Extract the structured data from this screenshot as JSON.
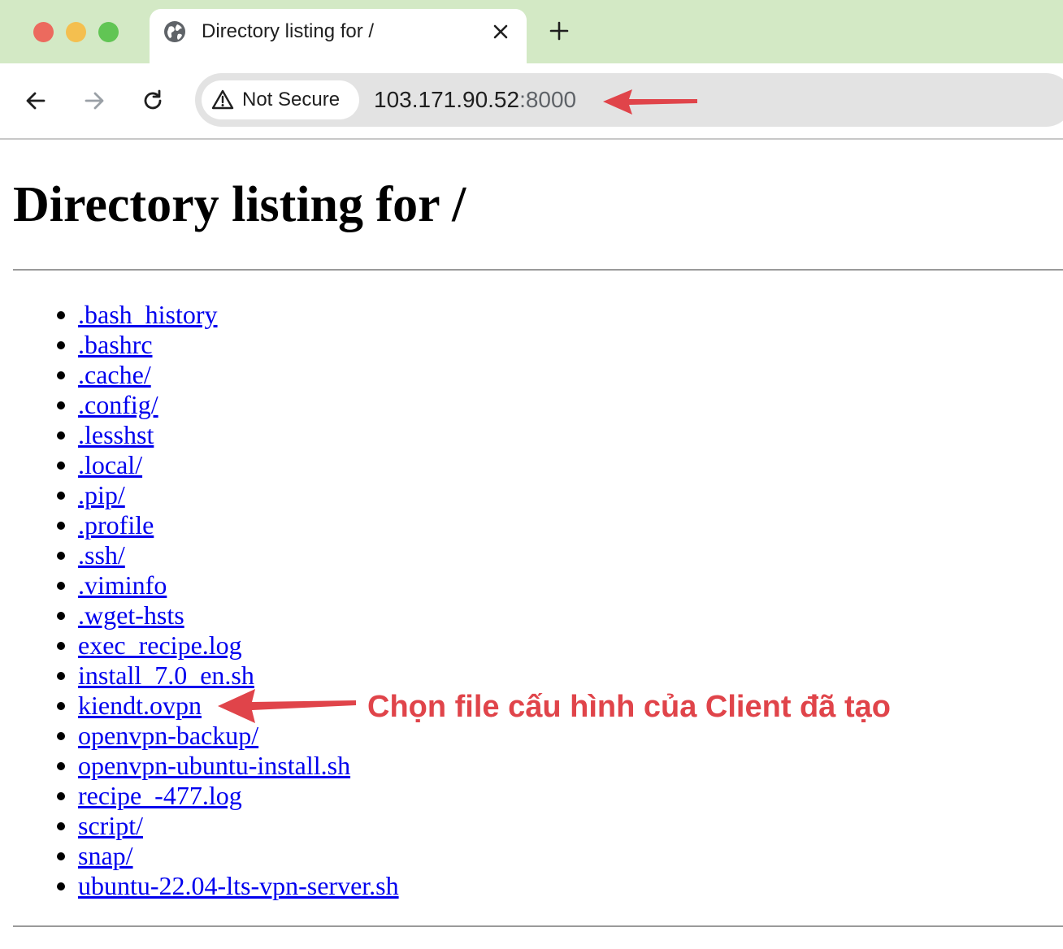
{
  "browser": {
    "tab": {
      "title": "Directory listing for /"
    },
    "address_bar": {
      "security_label": "Not Secure",
      "url_host": "103.171.90.52",
      "url_port": ":8000"
    }
  },
  "page": {
    "heading": "Directory listing for /",
    "files": [
      ".bash_history",
      ".bashrc",
      ".cache/",
      ".config/",
      ".lesshst",
      ".local/",
      ".pip/",
      ".profile",
      ".ssh/",
      ".viminfo",
      ".wget-hsts",
      "exec_recipe.log",
      "install_7.0_en.sh",
      "kiendt.ovpn",
      "openvpn-backup/",
      "openvpn-ubuntu-install.sh",
      "recipe_-477.log",
      "script/",
      "snap/",
      "ubuntu-22.04-lts-vpn-server.sh"
    ]
  },
  "annotation": {
    "text": "Chọn file cấu hình của Client đã tạo",
    "color": "#e0444a"
  },
  "colors": {
    "tabstrip": "#d3e9c5",
    "link": "#0000ee"
  }
}
